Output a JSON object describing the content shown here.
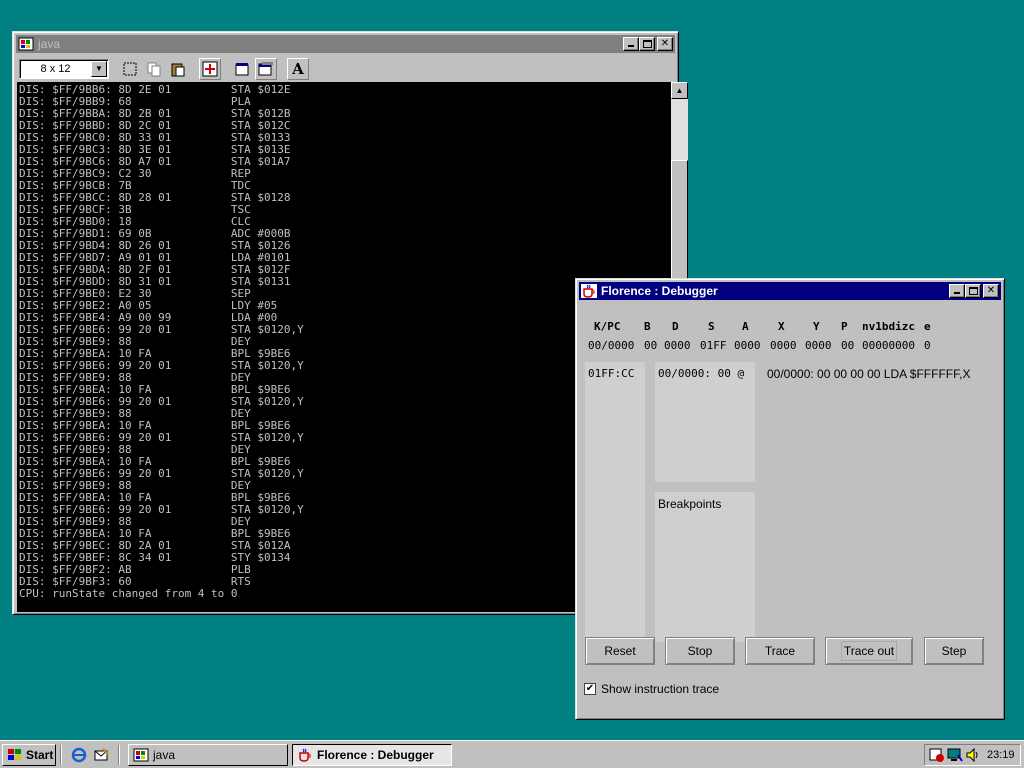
{
  "java_window": {
    "title": "java",
    "font_select": "8 x 12",
    "toolbar_icons": [
      "mark-icon",
      "copy-icon",
      "paste-icon",
      "fullscreen-icon",
      "properties-icon",
      "background-icon",
      "font-icon"
    ],
    "font_button_glyph": "A",
    "lines": [
      "DIS: $FF/9BB6: 8D 2E 01         STA $012E",
      "DIS: $FF/9BB9: 68               PLA",
      "DIS: $FF/9BBA: 8D 2B 01         STA $012B",
      "DIS: $FF/9BBD: 8D 2C 01         STA $012C",
      "DIS: $FF/9BC0: 8D 33 01         STA $0133",
      "DIS: $FF/9BC3: 8D 3E 01         STA $013E",
      "DIS: $FF/9BC6: 8D A7 01         STA $01A7",
      "DIS: $FF/9BC9: C2 30            REP",
      "DIS: $FF/9BCB: 7B               TDC",
      "DIS: $FF/9BCC: 8D 28 01         STA $0128",
      "DIS: $FF/9BCF: 3B               TSC",
      "DIS: $FF/9BD0: 18               CLC",
      "DIS: $FF/9BD1: 69 0B            ADC #000B",
      "DIS: $FF/9BD4: 8D 26 01         STA $0126",
      "DIS: $FF/9BD7: A9 01 01         LDA #0101",
      "DIS: $FF/9BDA: 8D 2F 01         STA $012F",
      "DIS: $FF/9BDD: 8D 31 01         STA $0131",
      "DIS: $FF/9BE0: E2 30            SEP",
      "DIS: $FF/9BE2: A0 05            LDY #05",
      "DIS: $FF/9BE4: A9 00 99         LDA #00",
      "DIS: $FF/9BE6: 99 20 01         STA $0120,Y",
      "DIS: $FF/9BE9: 88               DEY",
      "DIS: $FF/9BEA: 10 FA            BPL $9BE6",
      "DIS: $FF/9BE6: 99 20 01         STA $0120,Y",
      "DIS: $FF/9BE9: 88               DEY",
      "DIS: $FF/9BEA: 10 FA            BPL $9BE6",
      "DIS: $FF/9BE6: 99 20 01         STA $0120,Y",
      "DIS: $FF/9BE9: 88               DEY",
      "DIS: $FF/9BEA: 10 FA            BPL $9BE6",
      "DIS: $FF/9BE6: 99 20 01         STA $0120,Y",
      "DIS: $FF/9BE9: 88               DEY",
      "DIS: $FF/9BEA: 10 FA            BPL $9BE6",
      "DIS: $FF/9BE6: 99 20 01         STA $0120,Y",
      "DIS: $FF/9BE9: 88               DEY",
      "DIS: $FF/9BEA: 10 FA            BPL $9BE6",
      "DIS: $FF/9BE6: 99 20 01         STA $0120,Y",
      "DIS: $FF/9BE9: 88               DEY",
      "DIS: $FF/9BEA: 10 FA            BPL $9BE6",
      "DIS: $FF/9BEC: 8D 2A 01         STA $012A",
      "DIS: $FF/9BEF: 8C 34 01         STY $0134",
      "DIS: $FF/9BF2: AB               PLB",
      "DIS: $FF/9BF3: 60               RTS",
      "CPU: runState changed from 4 to 0"
    ]
  },
  "debugger": {
    "title": "Florence : Debugger",
    "registers": {
      "headers": [
        "K/PC",
        "B",
        "D",
        "S",
        "A",
        "X",
        "Y",
        "P",
        "nv1bdizc",
        "e"
      ],
      "values": [
        "00/0000",
        "00",
        "0000",
        "01FF",
        "0000",
        "0000",
        "0000",
        "00",
        "00000000",
        "0"
      ]
    },
    "stack_text": "01FF:CC",
    "memory_text": "00/0000: 00 @",
    "disasm_text": "00/0000: 00 00 00 00  LDA $FFFFFF,X",
    "breakpoints_label": "Breakpoints",
    "buttons": {
      "reset": "Reset",
      "stop": "Stop",
      "trace": "Trace",
      "trace_out": "Trace out",
      "step": "Step"
    },
    "show_trace_label": "Show instruction trace",
    "show_trace_checked": true
  },
  "taskbar": {
    "start_label": "Start",
    "tasks": [
      "java",
      "Florence : Debugger"
    ],
    "clock": "23:19"
  },
  "colors": {
    "desktop": "#008080",
    "active_title": "#000080",
    "inactive_title": "#808080",
    "console_bg": "#000000",
    "console_fg": "#c0c0c0"
  }
}
